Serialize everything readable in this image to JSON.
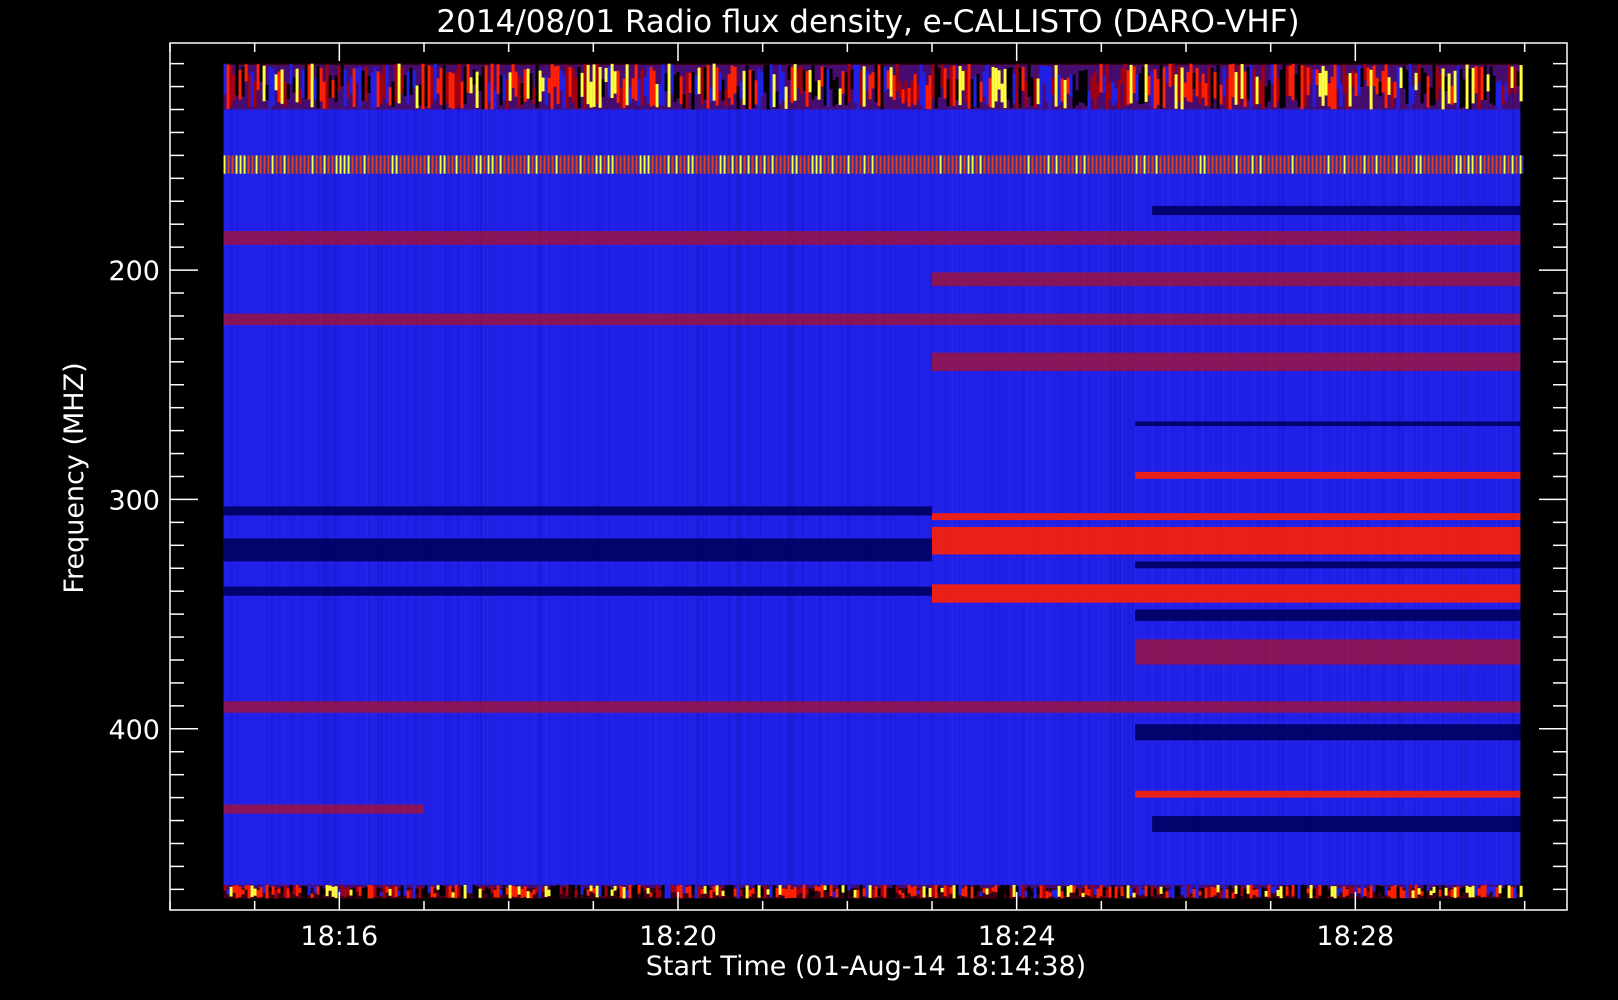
{
  "chart_data": {
    "type": "heatmap",
    "title": "2014/08/01  Radio flux density, e-CALLISTO (DARO-VHF)",
    "xlabel": "Start Time (01-Aug-14 18:14:38)",
    "ylabel": "Frequency (MHZ)",
    "x_tick_labels": [
      "18:16",
      "18:20",
      "18:24",
      "18:28"
    ],
    "x_tick_minutes": [
      16,
      20,
      24,
      28
    ],
    "x_range_minutes": [
      14.0,
      30.5
    ],
    "data_time_range_minutes": [
      14.633,
      29.95
    ],
    "y_tick_labels": [
      "200",
      "300",
      "400"
    ],
    "y_tick_values": [
      200,
      300,
      400
    ],
    "y_range": [
      101,
      479
    ],
    "y_inverted": true,
    "colormap": {
      "background": "#2020e8",
      "dark": "#000060",
      "medium": "#c01010",
      "strong": "#ff2000",
      "peak": "#ffff40"
    },
    "bands": [
      {
        "freq_start": 110,
        "freq_end": 130,
        "level": "rfi-noisy",
        "t_start": 14.633,
        "t_end": 29.95
      },
      {
        "freq_start": 150,
        "freq_end": 158,
        "level": "rfi-comb",
        "t_start": 14.633,
        "t_end": 29.95
      },
      {
        "freq_start": 183,
        "freq_end": 189,
        "level": "medium",
        "t_start": 14.633,
        "t_end": 29.95
      },
      {
        "freq_start": 201,
        "freq_end": 207,
        "level": "medium",
        "t_start": 23.0,
        "t_end": 29.95
      },
      {
        "freq_start": 219,
        "freq_end": 224,
        "level": "medium",
        "t_start": 14.633,
        "t_end": 29.95
      },
      {
        "freq_start": 236,
        "freq_end": 244,
        "level": "medium",
        "t_start": 23.0,
        "t_end": 29.95
      },
      {
        "freq_start": 288,
        "freq_end": 291,
        "level": "strong",
        "t_start": 25.4,
        "t_end": 29.95
      },
      {
        "freq_start": 306,
        "freq_end": 309,
        "level": "strong",
        "t_start": 23.0,
        "t_end": 29.95
      },
      {
        "freq_start": 312,
        "freq_end": 324,
        "level": "strong",
        "t_start": 23.0,
        "t_end": 29.95
      },
      {
        "freq_start": 337,
        "freq_end": 345,
        "level": "strong",
        "t_start": 23.0,
        "t_end": 29.95
      },
      {
        "freq_start": 361,
        "freq_end": 372,
        "level": "medium",
        "t_start": 25.4,
        "t_end": 29.95
      },
      {
        "freq_start": 388,
        "freq_end": 393,
        "level": "medium",
        "t_start": 14.633,
        "t_end": 29.95
      },
      {
        "freq_start": 427,
        "freq_end": 430,
        "level": "strong",
        "t_start": 25.4,
        "t_end": 29.95
      },
      {
        "freq_start": 433,
        "freq_end": 437,
        "level": "medium",
        "t_start": 14.633,
        "t_end": 17.0
      },
      {
        "freq_start": 468,
        "freq_end": 474,
        "level": "rfi-noisy",
        "t_start": 14.633,
        "t_end": 29.95
      },
      {
        "freq_start": 317,
        "freq_end": 327,
        "level": "dark",
        "t_start": 14.633,
        "t_end": 23.0
      },
      {
        "freq_start": 303,
        "freq_end": 307,
        "level": "dark",
        "t_start": 14.633,
        "t_end": 23.0
      },
      {
        "freq_start": 338,
        "freq_end": 342,
        "level": "dark",
        "t_start": 14.633,
        "t_end": 23.0
      },
      {
        "freq_start": 266,
        "freq_end": 268,
        "level": "dark",
        "t_start": 25.4,
        "t_end": 29.95
      },
      {
        "freq_start": 327,
        "freq_end": 330,
        "level": "dark",
        "t_start": 25.4,
        "t_end": 29.95
      },
      {
        "freq_start": 348,
        "freq_end": 353,
        "level": "dark",
        "t_start": 25.4,
        "t_end": 29.95
      },
      {
        "freq_start": 398,
        "freq_end": 405,
        "level": "dark",
        "t_start": 25.4,
        "t_end": 29.95
      },
      {
        "freq_start": 438,
        "freq_end": 445,
        "level": "dark",
        "t_start": 25.6,
        "t_end": 29.95
      },
      {
        "freq_start": 172,
        "freq_end": 176,
        "level": "dark",
        "t_start": 25.6,
        "t_end": 29.95
      }
    ]
  }
}
